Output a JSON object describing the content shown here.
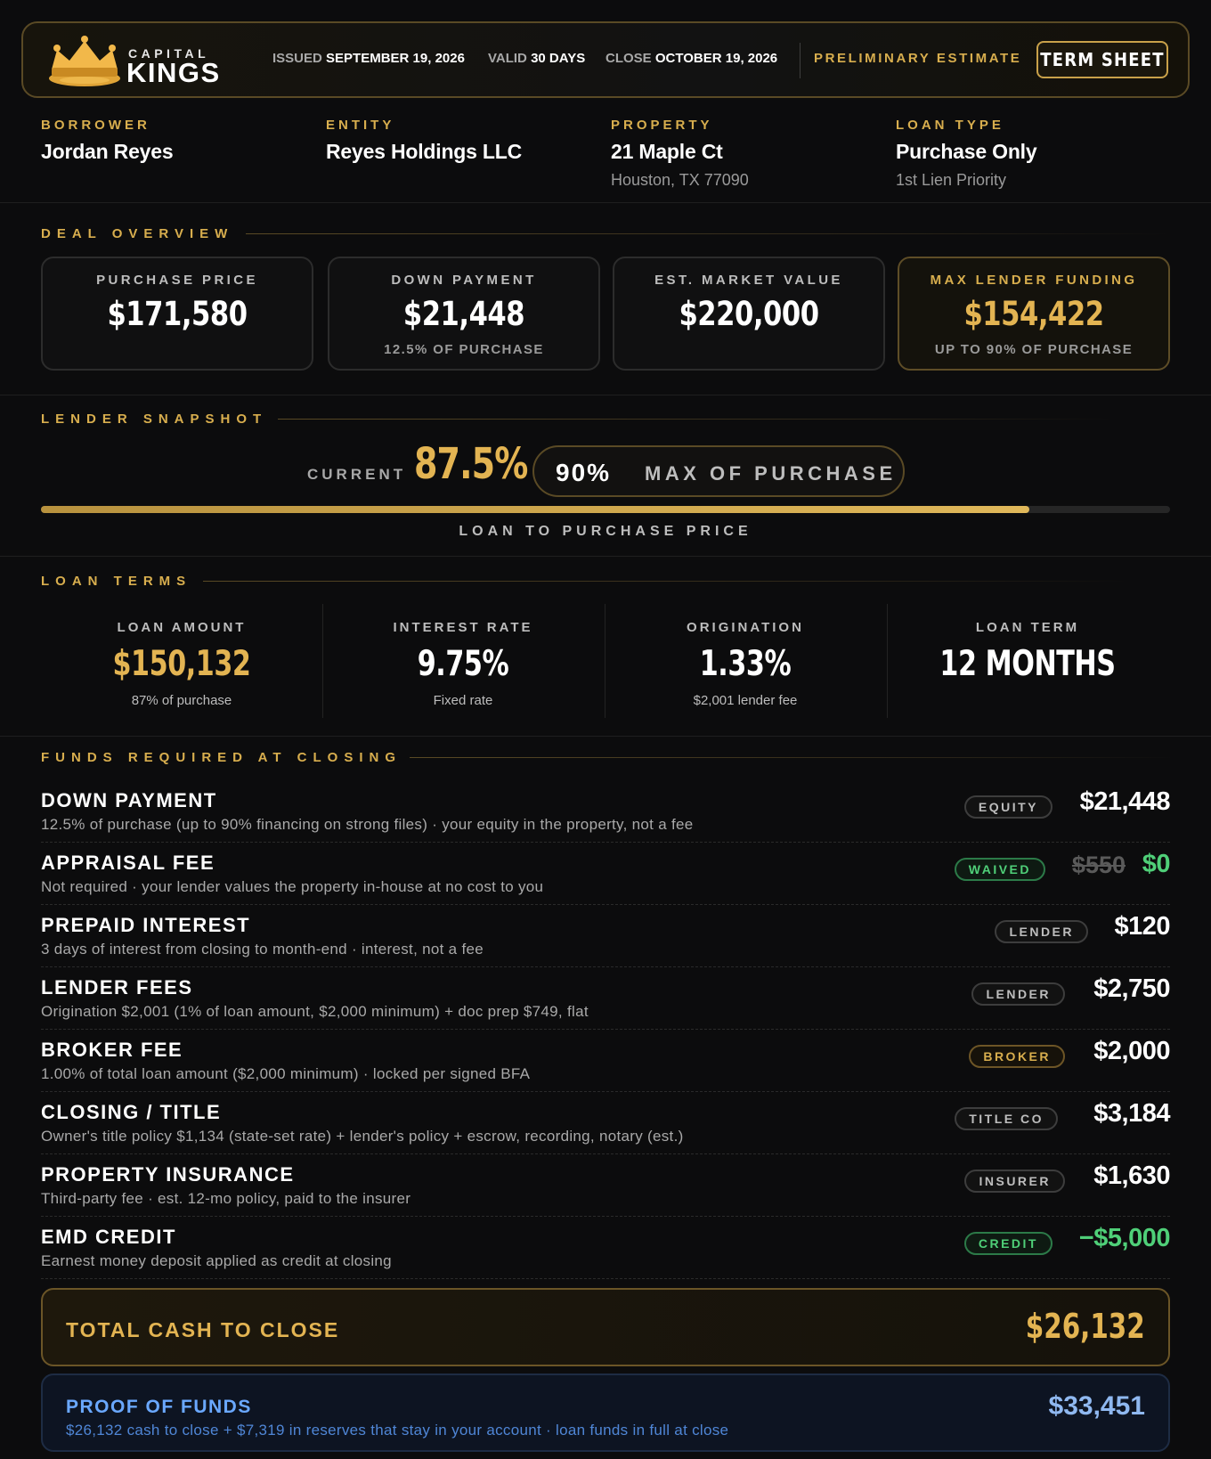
{
  "header": {
    "brand_small": "CAPITAL",
    "brand_big": "KINGS",
    "issued_label": "ISSUED",
    "issued_value": "SEPTEMBER 19, 2026",
    "valid_label": "VALID",
    "valid_value": "30 DAYS",
    "close_label": "CLOSE",
    "close_value": "OCTOBER 19, 2026",
    "status": "PRELIMINARY ESTIMATE",
    "term_sheet_button": "TERM SHEET",
    "logo_icon": "crown-icon"
  },
  "info": {
    "borrower_label": "BORROWER",
    "borrower_value": "Jordan Reyes",
    "entity_label": "ENTITY",
    "entity_value": "Reyes Holdings LLC",
    "property_label": "PROPERTY",
    "property_value": "21 Maple Ct",
    "property_sub": "Houston, TX 77090",
    "loan_type_label": "LOAN TYPE",
    "loan_type_value": "Purchase Only",
    "loan_type_sub": "1st Lien Priority"
  },
  "deal_overview": {
    "title": "DEAL OVERVIEW",
    "cards": [
      {
        "label": "PURCHASE PRICE",
        "value": "$171,580",
        "sub": ""
      },
      {
        "label": "DOWN PAYMENT",
        "value": "$21,448",
        "sub": "12.5% OF PURCHASE"
      },
      {
        "label": "EST. MARKET VALUE",
        "value": "$220,000",
        "sub": ""
      },
      {
        "label": "MAX LENDER FUNDING",
        "value": "$154,422",
        "sub": "UP TO 90% OF PURCHASE"
      }
    ]
  },
  "lender_snapshot": {
    "title": "LENDER SNAPSHOT",
    "current_label": "CURRENT",
    "current_value": "87.5%",
    "max_pct": "90%",
    "max_label": "MAX OF PURCHASE",
    "progress_fraction": 0.875,
    "caption": "LOAN TO PURCHASE PRICE"
  },
  "loan_terms": {
    "title": "LOAN TERMS",
    "items": [
      {
        "label": "LOAN AMOUNT",
        "value": "$150,132",
        "sub": "87% of purchase"
      },
      {
        "label": "INTEREST RATE",
        "value": "9.75%",
        "sub": "Fixed rate"
      },
      {
        "label": "ORIGINATION",
        "value": "1.33%",
        "sub": "$2,001 lender fee"
      },
      {
        "label": "LOAN TERM",
        "value": "12 MONTHS",
        "sub": ""
      }
    ]
  },
  "funds": {
    "title": "FUNDS REQUIRED AT CLOSING",
    "rows": [
      {
        "title": "DOWN PAYMENT",
        "desc": "12.5% of purchase (up to 90% financing on strong files) · your equity in the property, not a fee",
        "badge": "EQUITY",
        "amount": "$21,448"
      },
      {
        "title": "APPRAISAL FEE",
        "desc": "Not required · your lender values the property in-house at no cost to you",
        "badge": "WAIVED",
        "original": "$550",
        "amount": "$0"
      },
      {
        "title": "PREPAID INTEREST",
        "desc": "3 days of interest from closing to month-end · interest, not a fee",
        "badge": "LENDER",
        "amount": "$120"
      },
      {
        "title": "LENDER FEES",
        "desc": "Origination $2,001 (1% of loan amount, $2,000 minimum) + doc prep $749, flat",
        "badge": "LENDER",
        "amount": "$2,750"
      },
      {
        "title": "BROKER FEE",
        "desc": "1.00% of total loan amount ($2,000 minimum) · locked per signed BFA",
        "badge": "BROKER",
        "amount": "$2,000"
      },
      {
        "title": "CLOSING / TITLE",
        "desc": "Owner's title policy $1,134 (state-set rate) + lender's policy + escrow, recording, notary (est.)",
        "badge": "TITLE CO",
        "amount": "$3,184"
      },
      {
        "title": "PROPERTY INSURANCE",
        "desc": "Third-party fee · est. 12-mo policy, paid to the insurer",
        "badge": "INSURER",
        "amount": "$1,630"
      },
      {
        "title": "EMD CREDIT",
        "desc": "Earnest money deposit applied as credit at closing",
        "badge": "CREDIT",
        "amount": "−$5,000"
      }
    ],
    "total_label": "TOTAL CASH TO CLOSE",
    "total_amount": "$26,132",
    "pof_label": "PROOF OF FUNDS",
    "pof_desc": "$26,132 cash to close + $7,319 in reserves that stay in your account · loan funds in full at close",
    "pof_amount": "$33,451"
  },
  "colors": {
    "gold": "#d8ae4e",
    "green": "#4fcf78",
    "blue": "#6aa8ff",
    "background": "#0c0c0d"
  }
}
